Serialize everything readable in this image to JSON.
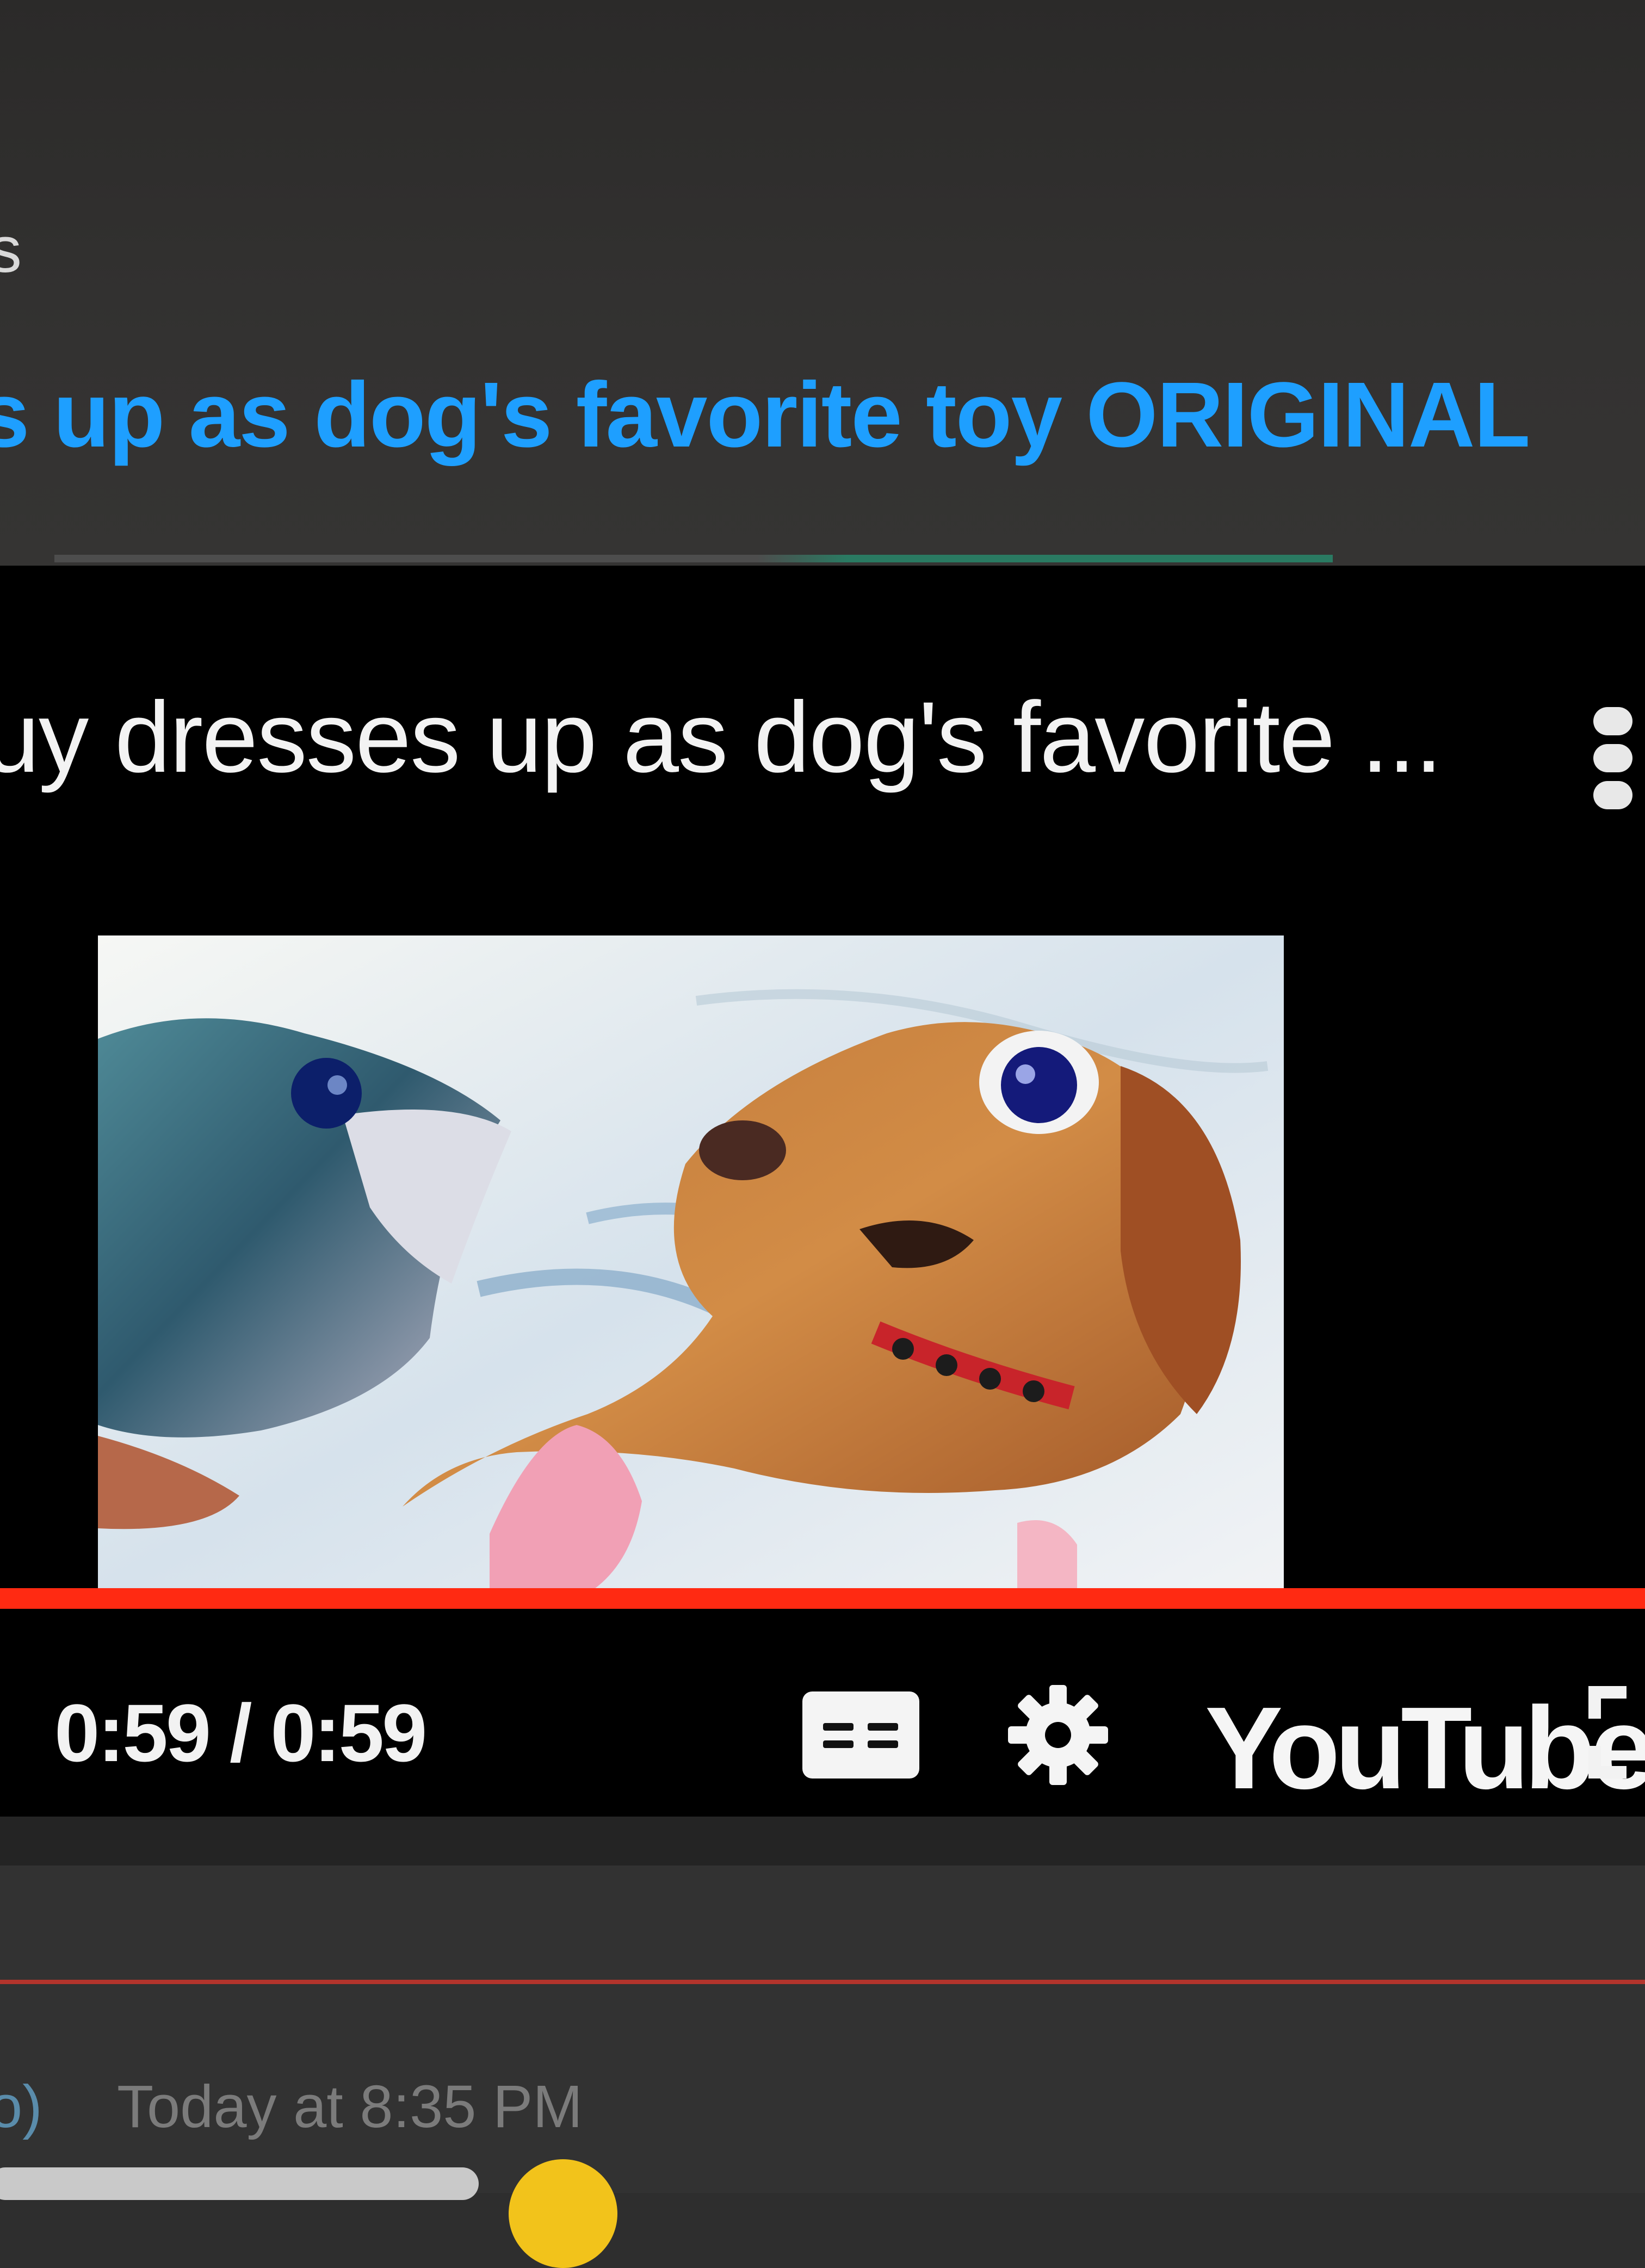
{
  "top": {
    "fragment": "s",
    "link_title": "s up as dog's favorite toy ORIGINAL"
  },
  "player": {
    "title": "uy dresses up as dog's favorite ...",
    "time": "0:59 / 0:59",
    "progress": 1.0,
    "logo": "YouTube",
    "icons": [
      "more-vert-icon",
      "closed-captions-icon",
      "gear-icon",
      "fullscreen-icon"
    ]
  },
  "message": {
    "timestamp_prefix": "o)",
    "timestamp": "Today at 8:35 PM"
  },
  "colors": {
    "link": "#1e9fff",
    "progress": "#ff2a12",
    "player_bg": "#000000"
  }
}
